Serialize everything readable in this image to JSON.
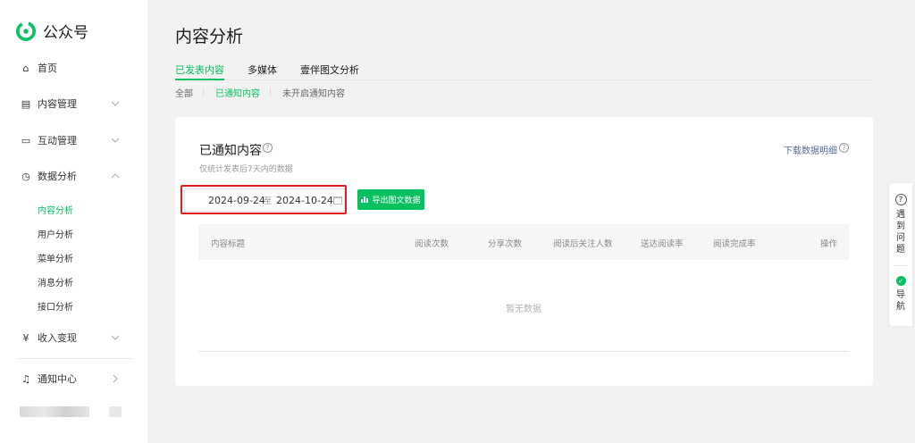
{
  "brand": {
    "name": "公众号"
  },
  "sidebar": {
    "items": [
      {
        "label": "首页",
        "icon": "home-icon"
      },
      {
        "label": "内容管理",
        "icon": "document-icon"
      },
      {
        "label": "互动管理",
        "icon": "chat-icon"
      },
      {
        "label": "数据分析",
        "icon": "clock-icon"
      },
      {
        "label": "收入变现",
        "icon": "yen-icon"
      },
      {
        "label": "通知中心",
        "icon": "bell-icon"
      }
    ],
    "sub_items": [
      "内容分析",
      "用户分析",
      "菜单分析",
      "消息分析",
      "接口分析"
    ]
  },
  "main": {
    "title": "内容分析",
    "tabs": [
      "已发表内容",
      "多媒体",
      "壹伴图文分析"
    ],
    "subtabs": [
      "全部",
      "已通知内容",
      "未开启通知内容"
    ],
    "card": {
      "title": "已通知内容",
      "subtitle": "仅统计发表后7天内的数据",
      "download_label": "下载数据明细",
      "date_start": "2024-09-24",
      "date_sep": "至",
      "date_end": "2024-10-24",
      "export_label": "导出图文数据",
      "columns": [
        "内容标题",
        "阅读次数",
        "分享次数",
        "阅读后关注人数",
        "送达阅读率",
        "阅读完成率",
        "操作"
      ],
      "empty_text": "暂无数据"
    }
  },
  "float_panel": {
    "help_label": "遇到问题",
    "nav_label": "导航"
  },
  "colors": {
    "accent": "#07c160",
    "link": "#576b95",
    "highlight": "#e02020"
  }
}
